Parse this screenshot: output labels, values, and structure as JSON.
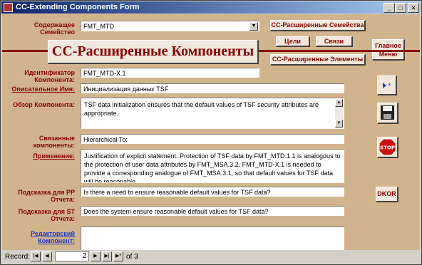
{
  "window": {
    "title": "CC-Extending Components Form"
  },
  "labels": {
    "family": "Содержащее Семейство",
    "identifier": "Идентификатор Компонента:",
    "desc_name": "Описательное Имя:",
    "overview": "Обзор Компонента:",
    "related": "Связанные компоненты:",
    "application": "Применение:",
    "pp_hint": "Подсказка для PP Отчета:",
    "st_hint": "Подсказка для ST Отчета:",
    "editorial": "Редакторский Компонент:"
  },
  "fields": {
    "family": "FMT_MTD",
    "identifier": "FMT_MTD-X.1",
    "desc_name": "Инициализация данных TSF",
    "overview": "TSF data initialization ensures that the default values of TSF security attributes are appropriate.",
    "related": "Hierarchical To:",
    "application": "Justification of explicit statement.  Protection of TSF data by FMT_MTD.1.1 is analogous to the protection of user data attributes by FMT_MSA.3.2.  FMT_MTD-X.1 is needed to provide a corresponding analogue of FMT_MSA.3.1, so that default values for TSF data will be reasonable.",
    "pp_hint": "Is there a need to ensure reasonable default values for TSF data?",
    "st_hint": "Does the system ensure reasonable default values for TSF data?",
    "editorial": ""
  },
  "buttons": {
    "families": "CC-Расширенные Семейства",
    "goals": "Цели",
    "links": "Связи",
    "elements": "CC-Расширенные Элементы",
    "main_menu": "Главное Меню",
    "dkor": "DKOR",
    "stop": "STOP"
  },
  "banner": {
    "title": "CC-Расширенные Компоненты"
  },
  "navigation": {
    "record_label": "Record:",
    "current": "2",
    "of_label": "of",
    "total": "3"
  }
}
